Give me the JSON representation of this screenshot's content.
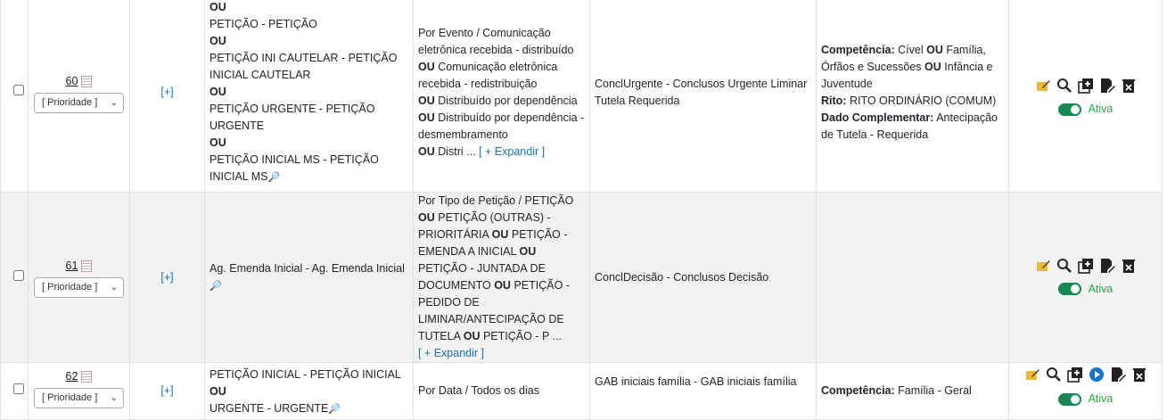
{
  "priority_placeholder": "[ Prioridade ]",
  "expand_tree_label": "[+]",
  "expand_text_label": "[ + Expandir ]",
  "status_label": "Ativa",
  "or": "OU",
  "rows": [
    {
      "number": "60",
      "classes": [
        "OU",
        "PETIÇÃO - PETIÇÃO",
        "OU",
        "PETIÇÃO INI CAUTELAR - PETIÇÃO INICIAL CAUTELAR",
        "OU",
        "PETIÇÃO URGENTE - PETIÇÃO URGENTE",
        "OU",
        "PETIÇÃO INICIAL MS - PETIÇÃO INICIAL MS"
      ],
      "event": {
        "title": "Por Evento / Comunicação eletrônica recebida - distribuído",
        "items": [
          "Comunicação eletrônica recebida - redistribuição",
          "Distribuído por dependência",
          "Distribuído por dependência - desmembramento",
          "Distri ..."
        ]
      },
      "localizador": "ConclUrgente - Conclusos Urgente Liminar Tutela Requerida",
      "conditions": {
        "competencia_label": "Competência:",
        "competencia_a": "Cível",
        "competencia_b": "Família, Órfãos e Sucessões",
        "competencia_c": "Infância e Juventude",
        "rito_label": "Rito:",
        "rito_value": "RITO ORDINÁRIO (COMUM)",
        "dado_label": "Dado Complementar:",
        "dado_value": "Antecipação de Tutela - Requerida"
      }
    },
    {
      "number": "61",
      "classes": [
        "Ag. Emenda Inicial - Ag. Emenda Inicial"
      ],
      "event": {
        "title": "Por Tipo de Petição / PETIÇÃO",
        "items": [
          "PETIÇÃO (OUTRAS) - PRIORITÁRIA",
          "PETIÇÃO - EMENDA A INICIAL",
          "PETIÇÃO - JUNTADA DE DOCUMENTO",
          "PETIÇÃO - PEDIDO DE LIMINAR/ANTECIPAÇÃO DE TUTELA",
          "PETIÇÃO - P ..."
        ]
      },
      "localizador": "ConclDecisão - Conclusos Decisão"
    },
    {
      "number": "62",
      "classes": [
        "PETIÇÃO INICIAL - PETIÇÃO INICIAL",
        "OU",
        "URGENTE - URGENTE"
      ],
      "event": {
        "title": "Por Data / Todos os dias"
      },
      "localizador": "GAB iniciais família - GAB iniciais família",
      "conditions": {
        "competencia_label": "Competência:",
        "competencia_value": "Família - Geral"
      }
    }
  ],
  "icons": {
    "colors": {
      "edit": "#d9a520",
      "toggle": "#198754",
      "status": "#28a745",
      "link": "#1f6fb2",
      "run": "#1a73c9"
    }
  }
}
